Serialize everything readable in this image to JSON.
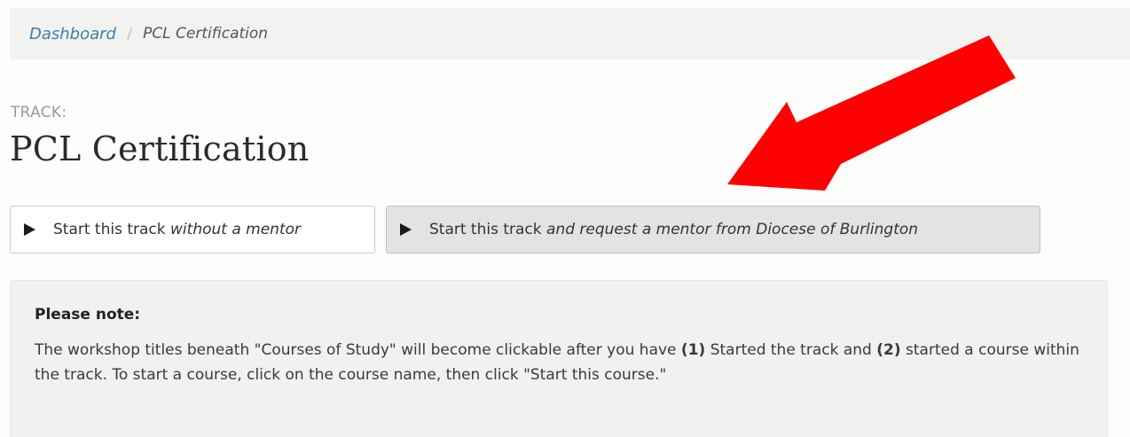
{
  "breadcrumb": {
    "home": "Dashboard",
    "separator": "/",
    "current": "PCL Certification"
  },
  "track": {
    "label": "TRACK:",
    "title": "PCL Certification"
  },
  "buttons": {
    "no_mentor": {
      "text": "Start this track ",
      "italic": "without a mentor"
    },
    "request_mentor": {
      "text": "Start this track ",
      "italic": "and request a mentor from Diocese of Burlington"
    }
  },
  "note": {
    "title": "Please note:",
    "part1": "The workshop titles beneath \"Courses of Study\" will become clickable after you have ",
    "num1": "(1)",
    "part2": " Started the track and ",
    "num2": "(2)",
    "part3": " started a course within the track. To start a course, click on the course name, then click \"Start this course.\""
  },
  "colors": {
    "link": "#3f7ea8",
    "annotation_arrow": "#ff0000",
    "breadcrumb_bg": "#f2f2f0",
    "note_bg": "#f1f1f0"
  },
  "icons": {
    "button_icon": "play-icon",
    "annotation": "arrow-annotation-icon"
  }
}
